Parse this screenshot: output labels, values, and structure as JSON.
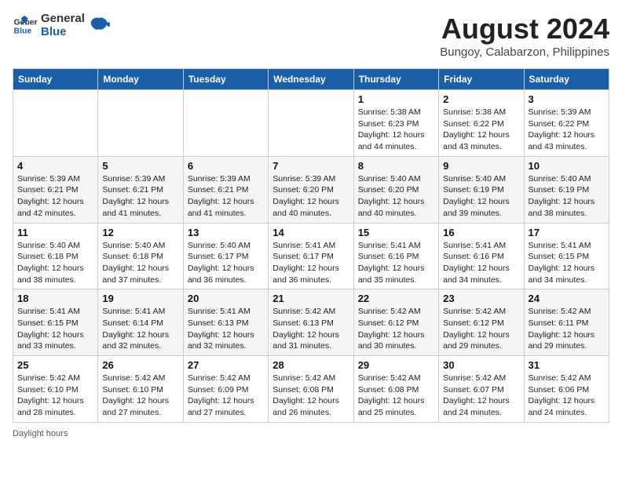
{
  "header": {
    "logo_line1": "General",
    "logo_line2": "Blue",
    "main_title": "August 2024",
    "subtitle": "Bungoy, Calabarzon, Philippines"
  },
  "calendar": {
    "days_of_week": [
      "Sunday",
      "Monday",
      "Tuesday",
      "Wednesday",
      "Thursday",
      "Friday",
      "Saturday"
    ],
    "weeks": [
      [
        {
          "day": "",
          "info": ""
        },
        {
          "day": "",
          "info": ""
        },
        {
          "day": "",
          "info": ""
        },
        {
          "day": "",
          "info": ""
        },
        {
          "day": "1",
          "info": "Sunrise: 5:38 AM\nSunset: 6:23 PM\nDaylight: 12 hours\nand 44 minutes."
        },
        {
          "day": "2",
          "info": "Sunrise: 5:38 AM\nSunset: 6:22 PM\nDaylight: 12 hours\nand 43 minutes."
        },
        {
          "day": "3",
          "info": "Sunrise: 5:39 AM\nSunset: 6:22 PM\nDaylight: 12 hours\nand 43 minutes."
        }
      ],
      [
        {
          "day": "4",
          "info": "Sunrise: 5:39 AM\nSunset: 6:21 PM\nDaylight: 12 hours\nand 42 minutes."
        },
        {
          "day": "5",
          "info": "Sunrise: 5:39 AM\nSunset: 6:21 PM\nDaylight: 12 hours\nand 41 minutes."
        },
        {
          "day": "6",
          "info": "Sunrise: 5:39 AM\nSunset: 6:21 PM\nDaylight: 12 hours\nand 41 minutes."
        },
        {
          "day": "7",
          "info": "Sunrise: 5:39 AM\nSunset: 6:20 PM\nDaylight: 12 hours\nand 40 minutes."
        },
        {
          "day": "8",
          "info": "Sunrise: 5:40 AM\nSunset: 6:20 PM\nDaylight: 12 hours\nand 40 minutes."
        },
        {
          "day": "9",
          "info": "Sunrise: 5:40 AM\nSunset: 6:19 PM\nDaylight: 12 hours\nand 39 minutes."
        },
        {
          "day": "10",
          "info": "Sunrise: 5:40 AM\nSunset: 6:19 PM\nDaylight: 12 hours\nand 38 minutes."
        }
      ],
      [
        {
          "day": "11",
          "info": "Sunrise: 5:40 AM\nSunset: 6:18 PM\nDaylight: 12 hours\nand 38 minutes."
        },
        {
          "day": "12",
          "info": "Sunrise: 5:40 AM\nSunset: 6:18 PM\nDaylight: 12 hours\nand 37 minutes."
        },
        {
          "day": "13",
          "info": "Sunrise: 5:40 AM\nSunset: 6:17 PM\nDaylight: 12 hours\nand 36 minutes."
        },
        {
          "day": "14",
          "info": "Sunrise: 5:41 AM\nSunset: 6:17 PM\nDaylight: 12 hours\nand 36 minutes."
        },
        {
          "day": "15",
          "info": "Sunrise: 5:41 AM\nSunset: 6:16 PM\nDaylight: 12 hours\nand 35 minutes."
        },
        {
          "day": "16",
          "info": "Sunrise: 5:41 AM\nSunset: 6:16 PM\nDaylight: 12 hours\nand 34 minutes."
        },
        {
          "day": "17",
          "info": "Sunrise: 5:41 AM\nSunset: 6:15 PM\nDaylight: 12 hours\nand 34 minutes."
        }
      ],
      [
        {
          "day": "18",
          "info": "Sunrise: 5:41 AM\nSunset: 6:15 PM\nDaylight: 12 hours\nand 33 minutes."
        },
        {
          "day": "19",
          "info": "Sunrise: 5:41 AM\nSunset: 6:14 PM\nDaylight: 12 hours\nand 32 minutes."
        },
        {
          "day": "20",
          "info": "Sunrise: 5:41 AM\nSunset: 6:13 PM\nDaylight: 12 hours\nand 32 minutes."
        },
        {
          "day": "21",
          "info": "Sunrise: 5:42 AM\nSunset: 6:13 PM\nDaylight: 12 hours\nand 31 minutes."
        },
        {
          "day": "22",
          "info": "Sunrise: 5:42 AM\nSunset: 6:12 PM\nDaylight: 12 hours\nand 30 minutes."
        },
        {
          "day": "23",
          "info": "Sunrise: 5:42 AM\nSunset: 6:12 PM\nDaylight: 12 hours\nand 29 minutes."
        },
        {
          "day": "24",
          "info": "Sunrise: 5:42 AM\nSunset: 6:11 PM\nDaylight: 12 hours\nand 29 minutes."
        }
      ],
      [
        {
          "day": "25",
          "info": "Sunrise: 5:42 AM\nSunset: 6:10 PM\nDaylight: 12 hours\nand 28 minutes."
        },
        {
          "day": "26",
          "info": "Sunrise: 5:42 AM\nSunset: 6:10 PM\nDaylight: 12 hours\nand 27 minutes."
        },
        {
          "day": "27",
          "info": "Sunrise: 5:42 AM\nSunset: 6:09 PM\nDaylight: 12 hours\nand 27 minutes."
        },
        {
          "day": "28",
          "info": "Sunrise: 5:42 AM\nSunset: 6:08 PM\nDaylight: 12 hours\nand 26 minutes."
        },
        {
          "day": "29",
          "info": "Sunrise: 5:42 AM\nSunset: 6:08 PM\nDaylight: 12 hours\nand 25 minutes."
        },
        {
          "day": "30",
          "info": "Sunrise: 5:42 AM\nSunset: 6:07 PM\nDaylight: 12 hours\nand 24 minutes."
        },
        {
          "day": "31",
          "info": "Sunrise: 5:42 AM\nSunset: 6:06 PM\nDaylight: 12 hours\nand 24 minutes."
        }
      ]
    ]
  },
  "footer": {
    "note": "Daylight hours"
  }
}
